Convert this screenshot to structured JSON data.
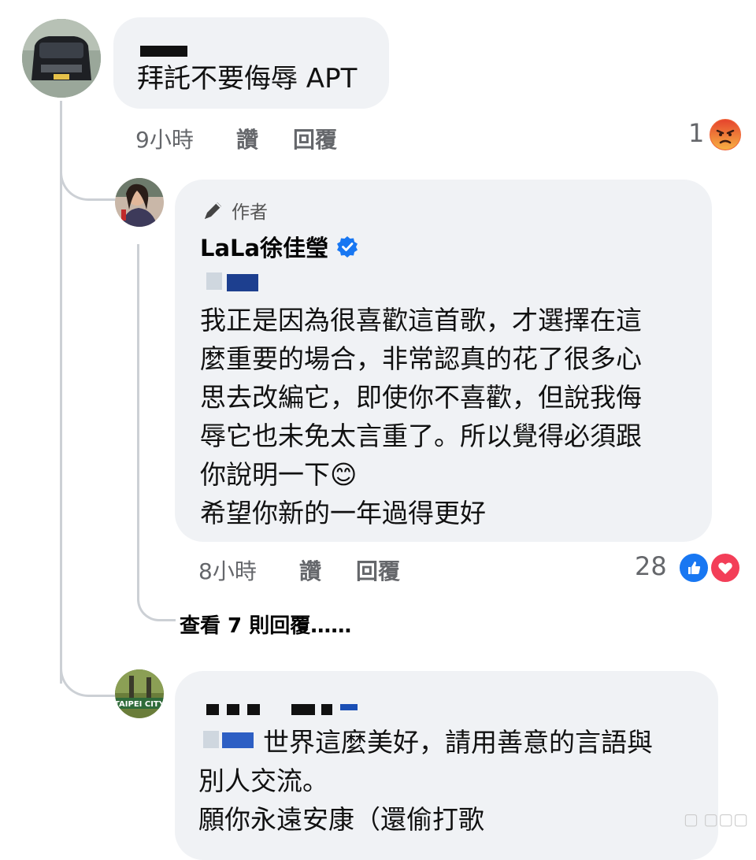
{
  "comment1": {
    "text": "拜託不要侮辱 APT",
    "time": "9小時",
    "like_label": "讚",
    "reply_label": "回覆",
    "reaction_count": "1",
    "reaction_icon": "angry-reaction-icon"
  },
  "reply1": {
    "badge": "作者",
    "author_name": "LaLa徐佳瑩",
    "lines": [
      "我正是因為很喜歡這首歌，才選擇在這",
      "麼重要的場合，非常認真的花了很多心",
      "思去改編它，即使你不喜歡，但說我侮",
      "辱它也未免太言重了。所以覺得必須跟",
      "你說明一下😊",
      "希望你新的一年過得更好"
    ],
    "time": "8小時",
    "like_label": "讚",
    "reply_label": "回覆",
    "reaction_count": "28",
    "reaction_icons": [
      "like-reaction-icon",
      "love-reaction-icon"
    ]
  },
  "view_replies": "查看 7 則回覆……",
  "comment2": {
    "avatar_text": "TAIPEI CITY",
    "lines": [
      "世界這麼美好，請用善意的言語與",
      "別人交流。",
      "願你永遠安康（還偷打歌"
    ]
  },
  "colors": {
    "bubble": "#f0f2f5",
    "meta": "#65676b",
    "verified": "#1877f2",
    "like": "#1877f2",
    "love": "#f33e58",
    "angry": "#f0663a"
  }
}
